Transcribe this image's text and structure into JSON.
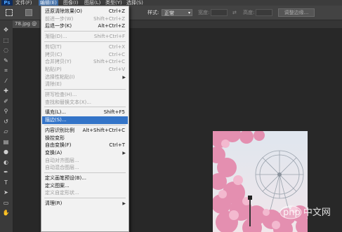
{
  "app": {
    "logo_text": "Ps",
    "menubar": [
      {
        "label": "文件(F)",
        "active": false
      },
      {
        "label": "编辑(E)",
        "active": true
      },
      {
        "label": "图像(I)",
        "active": false
      },
      {
        "label": "图层(L)",
        "active": false
      },
      {
        "label": "类型(Y)",
        "active": false
      },
      {
        "label": "选择(S)",
        "active": false
      }
    ]
  },
  "options_bar": {
    "style_label": "样式:",
    "style_value": "正常",
    "width_label": "宽度:",
    "height_label": "高度:",
    "refine_edge_button": "调整边缘..."
  },
  "tab": {
    "title": "78.jpg @"
  },
  "edit_menu": {
    "items": [
      {
        "label": "还原清除效果(O)",
        "shortcut": "Ctrl+Z",
        "enabled": true
      },
      {
        "label": "前进一步(W)",
        "shortcut": "Shift+Ctrl+Z",
        "enabled": false
      },
      {
        "label": "后退一步(K)",
        "shortcut": "Alt+Ctrl+Z",
        "enabled": true
      },
      {
        "separator": true
      },
      {
        "label": "渐隐(D)...",
        "shortcut": "Shift+Ctrl+F",
        "enabled": false
      },
      {
        "separator": true
      },
      {
        "label": "剪切(T)",
        "shortcut": "Ctrl+X",
        "enabled": false
      },
      {
        "label": "拷贝(C)",
        "shortcut": "Ctrl+C",
        "enabled": false
      },
      {
        "label": "合并拷贝(Y)",
        "shortcut": "Shift+Ctrl+C",
        "enabled": false
      },
      {
        "label": "粘贴(P)",
        "shortcut": "Ctrl+V",
        "enabled": false
      },
      {
        "label": "选择性粘贴(I)",
        "shortcut": "",
        "enabled": false,
        "submenu": true
      },
      {
        "label": "清除(E)",
        "shortcut": "",
        "enabled": false
      },
      {
        "separator": true
      },
      {
        "label": "拼写检查(H)...",
        "shortcut": "",
        "enabled": false
      },
      {
        "label": "查找和替换文本(X)...",
        "shortcut": "",
        "enabled": false
      },
      {
        "separator": true
      },
      {
        "label": "填充(L)...",
        "shortcut": "Shift+F5",
        "enabled": true
      },
      {
        "label": "描边(S)...",
        "shortcut": "",
        "enabled": true,
        "highlighted": true
      },
      {
        "separator": true
      },
      {
        "label": "内容识别比例",
        "shortcut": "Alt+Shift+Ctrl+C",
        "enabled": true
      },
      {
        "label": "操控变形",
        "shortcut": "",
        "enabled": true
      },
      {
        "label": "自由变换(F)",
        "shortcut": "Ctrl+T",
        "enabled": true
      },
      {
        "label": "变换(A)",
        "shortcut": "",
        "enabled": true,
        "submenu": true
      },
      {
        "label": "自动对齐图层...",
        "shortcut": "",
        "enabled": false
      },
      {
        "label": "自动混合图层...",
        "shortcut": "",
        "enabled": false
      },
      {
        "separator": true
      },
      {
        "label": "定义画笔预设(B)...",
        "shortcut": "",
        "enabled": true
      },
      {
        "label": "定义图案...",
        "shortcut": "",
        "enabled": true
      },
      {
        "label": "定义自定形状...",
        "shortcut": "",
        "enabled": false
      },
      {
        "separator": true
      },
      {
        "label": "清理(R)",
        "shortcut": "",
        "enabled": true,
        "submenu": true
      }
    ]
  },
  "watermark": "php 中文网",
  "tools": [
    "move-icon",
    "marquee-icon",
    "lasso-icon",
    "quick-select-icon",
    "crop-icon",
    "eyedropper-icon",
    "healing-brush-icon",
    "brush-icon",
    "clone-stamp-icon",
    "history-brush-icon",
    "eraser-icon",
    "gradient-icon",
    "blur-icon",
    "dodge-icon",
    "pen-icon",
    "type-icon",
    "path-select-icon",
    "shape-icon",
    "hand-icon"
  ],
  "colors": {
    "highlight": "#3374c8",
    "app_bg": "#282828",
    "panel": "#3a3a3a"
  }
}
